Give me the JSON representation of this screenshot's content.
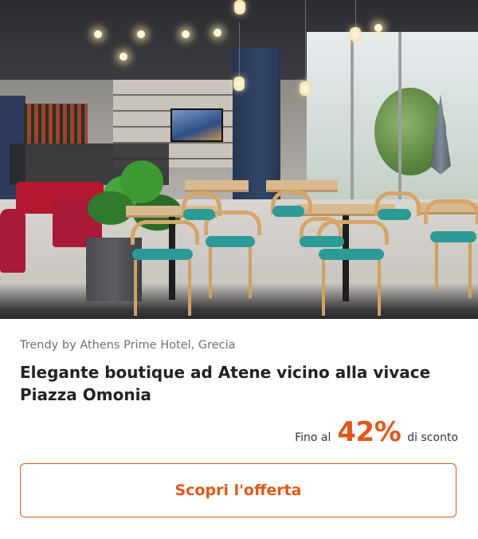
{
  "offer": {
    "hotel_name": "Trendy by Athens Prime Hotel, Grecia",
    "title": "Elegante boutique ad Atene vicino alla vivace Piazza Omonia",
    "discount_prefix": "Fino al",
    "discount_value": "42%",
    "discount_suffix": "di sconto",
    "cta_label": "Scopri l'offerta"
  },
  "theme": {
    "accent": "#e2581a",
    "title_color": "#222222",
    "subtitle_color": "#6f6f6f"
  }
}
